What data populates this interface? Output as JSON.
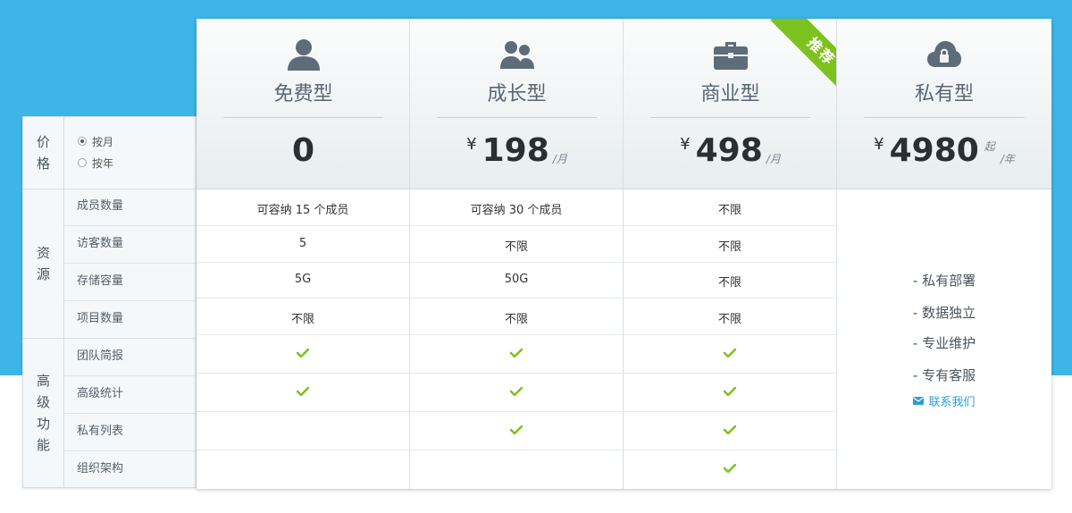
{
  "sidebar": {
    "price_group": [
      "价",
      "格"
    ],
    "billing": [
      {
        "label": "按月",
        "checked": true
      },
      {
        "label": "按年",
        "checked": false
      }
    ],
    "resource_group": [
      "资",
      "源"
    ],
    "resource_rows": [
      "成员数量",
      "访客数量",
      "存储容量",
      "项目数量"
    ],
    "advanced_group": [
      "高",
      "级",
      "功",
      "能"
    ],
    "advanced_rows": [
      "团队简报",
      "高级统计",
      "私有列表",
      "组织架构"
    ]
  },
  "plans": [
    {
      "name": "免费型",
      "icon": "user-icon",
      "currency": "",
      "price": "0",
      "unit": "",
      "from": "",
      "resources": [
        "可容纳 15 个成员",
        "5",
        "5G",
        "不限"
      ],
      "features": [
        true,
        true,
        false,
        false
      ]
    },
    {
      "name": "成长型",
      "icon": "users-icon",
      "currency": "¥",
      "price": "198",
      "unit": "/月",
      "from": "",
      "resources": [
        "可容纳 30 个成员",
        "不限",
        "50G",
        "不限"
      ],
      "features": [
        true,
        true,
        true,
        false
      ]
    },
    {
      "name": "商业型",
      "icon": "briefcase-icon",
      "currency": "¥",
      "price": "498",
      "unit": "/月",
      "from": "",
      "recommended_label": "推荐",
      "resources": [
        "不限",
        "不限",
        "不限",
        "不限"
      ],
      "features": [
        true,
        true,
        true,
        true
      ]
    },
    {
      "name": "私有型",
      "icon": "cloud-lock-icon",
      "currency": "¥",
      "price": "4980",
      "unit": "/年",
      "from": "起",
      "private_features": [
        "- 私有部署",
        "- 数据独立",
        "- 专业维护",
        "- 专有客服"
      ],
      "contact_label": "联系我们",
      "contact_icon": "mail-icon"
    }
  ],
  "colors": {
    "background_band": "#3db5e6",
    "check": "#7dc21e",
    "ribbon": "#7dc21e",
    "link": "#2b9fd6"
  }
}
